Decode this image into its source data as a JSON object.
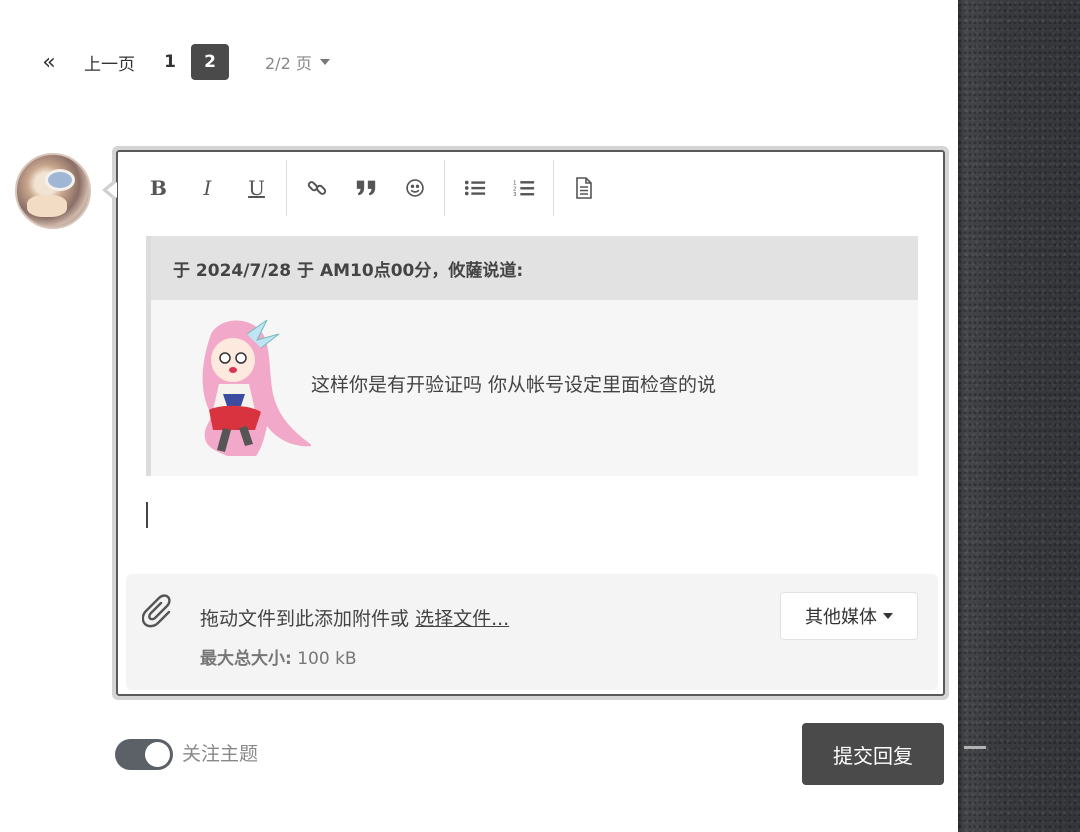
{
  "pagination": {
    "first_label": "«",
    "prev_label": "上一页",
    "pages": [
      "1",
      "2"
    ],
    "current_page": "2",
    "page_status": "2/2 页"
  },
  "toolbar": {
    "bold": "B",
    "italic": "I",
    "underline": "U"
  },
  "quote": {
    "header": "于 2024/7/28 于 AM10点00分，攸薩说道:",
    "text": "这样你是有开验证吗 你从帐号设定里面检查的说"
  },
  "attachments": {
    "drop_text": "拖动文件到此添加附件或",
    "choose_link": "选择文件...",
    "max_size_label": "最大总大小:",
    "max_size_value": "100 kB",
    "media_button": "其他媒体"
  },
  "footer": {
    "follow_label": "关注主题",
    "follow_enabled": true,
    "submit_label": "提交回复"
  },
  "colors": {
    "active_page_bg": "#4a4a4a",
    "submit_bg": "#4a4a4a",
    "toggle_bg": "#5c6168",
    "side_panel": "#3b3c40"
  }
}
